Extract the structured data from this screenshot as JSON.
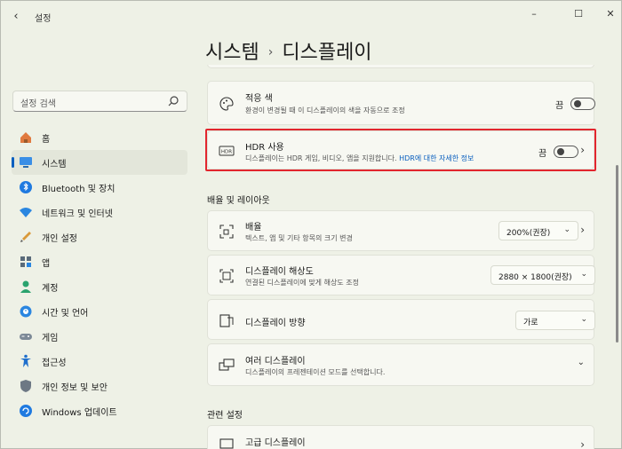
{
  "window": {
    "app_title": "설정",
    "back_icon": "back-arrow-icon"
  },
  "search": {
    "placeholder": "설정 검색"
  },
  "nav": [
    {
      "label": "홈",
      "icon": "home-icon"
    },
    {
      "label": "시스템",
      "icon": "system-icon",
      "active": true
    },
    {
      "label": "Bluetooth 및 장치",
      "icon": "bluetooth-icon"
    },
    {
      "label": "네트워크 및 인터넷",
      "icon": "network-icon"
    },
    {
      "label": "개인 설정",
      "icon": "brush-icon"
    },
    {
      "label": "앱",
      "icon": "apps-icon"
    },
    {
      "label": "계정",
      "icon": "account-icon"
    },
    {
      "label": "시간 및 언어",
      "icon": "globe-clock-icon"
    },
    {
      "label": "게임",
      "icon": "gamepad-icon"
    },
    {
      "label": "접근성",
      "icon": "accessibility-icon"
    },
    {
      "label": "개인 정보 및 보안",
      "icon": "shield-icon"
    },
    {
      "label": "Windows 업데이트",
      "icon": "update-icon"
    }
  ],
  "breadcrumb": {
    "parent": "시스템",
    "separator": "›",
    "current": "디스플레이"
  },
  "cards": {
    "adaptive_color": {
      "title": "적응 색",
      "desc": "환경이 변경될 때 이 디스플레이의 색을 자동으로 조정",
      "toggle_label": "끔"
    },
    "hdr": {
      "title": "HDR 사용",
      "desc": "디스플레이는 HDR 게임, 비디오, 앱을 지원합니다.",
      "link": "HDR에 대한 자세한 정보",
      "toggle_label": "끔",
      "icon_text": "HDR"
    },
    "scale": {
      "title": "배율",
      "desc": "텍스트, 앱 및 기타 항목의 크기 변경",
      "value": "200%(권장)"
    },
    "resolution": {
      "title": "디스플레이 해상도",
      "desc": "연결된 디스플레이에 맞게 해상도 조정",
      "value": "2880 × 1800(권장)"
    },
    "orientation": {
      "title": "디스플레이 방향",
      "value": "가로"
    },
    "multiple": {
      "title": "여러 디스플레이",
      "desc": "디스플레이의 프레젠테이션 모드를 선택합니다."
    },
    "advanced": {
      "title": "고급 디스플레이"
    }
  },
  "sections": {
    "scale_layout": "배율 및 레이아웃",
    "related": "관련 설정"
  },
  "colors": {
    "accent": "#0a5fbf",
    "highlight": "#e2262e",
    "background": "#eef1e6",
    "card": "#f7f8f2"
  }
}
